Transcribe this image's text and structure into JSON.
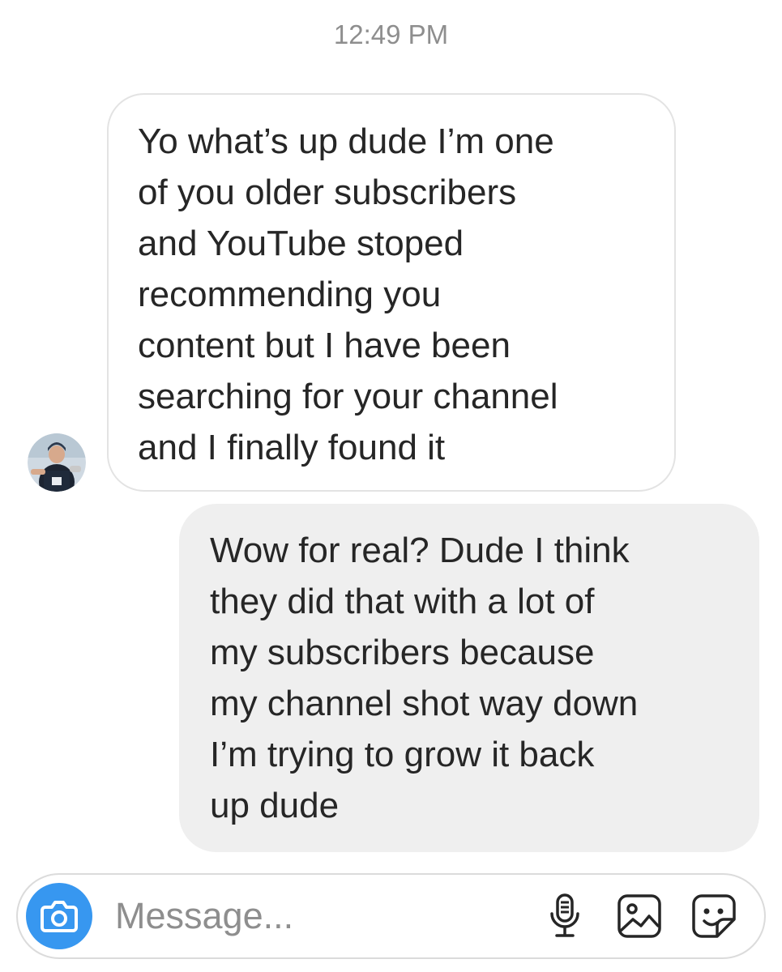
{
  "thread": {
    "timestamp": "12:49 PM",
    "messages": [
      {
        "direction": "incoming",
        "text": "Yo what’s up dude I’m one\nof you older subscribers\nand YouTube stoped\nrecommending you\ncontent but I have been\nsearching for your channel\nand I finally found it"
      },
      {
        "direction": "outgoing",
        "text": "Wow for real? Dude I think\nthey did that with a lot of\nmy subscribers because\nmy channel shot way down\nI’m trying to grow it back\nup dude"
      }
    ]
  },
  "composer": {
    "placeholder": "Message...",
    "value": "",
    "icons": [
      "camera-icon",
      "microphone-icon",
      "image-icon",
      "sticker-icon"
    ],
    "accent_color": "#3797f0"
  },
  "avatar": {
    "icon": "sender-avatar"
  }
}
